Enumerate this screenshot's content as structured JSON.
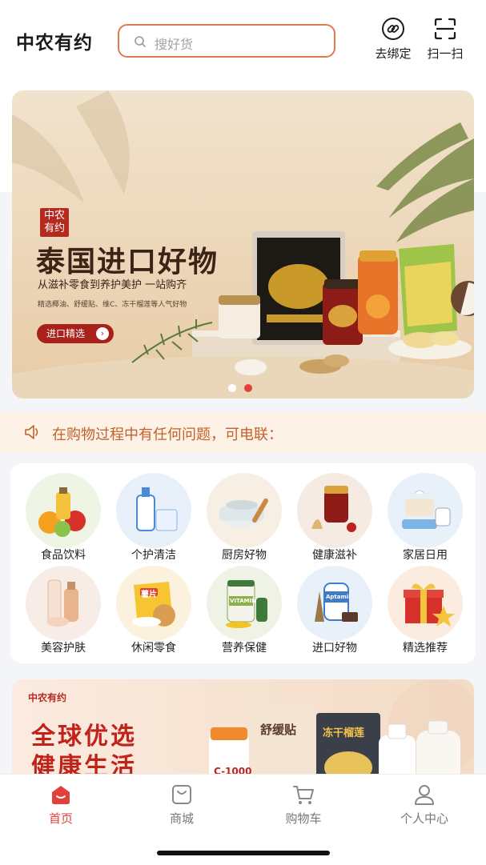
{
  "header": {
    "app_title": "中农有约",
    "search_placeholder": "搜好货",
    "bind_label": "去绑定",
    "scan_label": "扫一扫"
  },
  "banner": {
    "stamp_line1": "中农",
    "stamp_line2": "有约",
    "title": "泰国进口好物",
    "subtitle": "从滋补零食到养护美护 一站购齐",
    "description": "精选椰油、舒缓贴、维C、冻干榴莲等人气好物",
    "button_label": "进口精选",
    "button_arrow": "›",
    "slide_count": 2,
    "active_slide": 2
  },
  "notice": {
    "icon": "speaker-icon",
    "text": "在购物过程中有任何问题，可电联："
  },
  "categories": [
    {
      "label": "食品饮料",
      "icon": "fruit-drink-icon",
      "bg": "#eef5e4"
    },
    {
      "label": "个护清洁",
      "icon": "personal-care-icon",
      "bg": "#e8f0fa"
    },
    {
      "label": "厨房好物",
      "icon": "cookware-icon",
      "bg": "#f7efe4"
    },
    {
      "label": "健康滋补",
      "icon": "ginseng-tonic-icon",
      "bg": "#f6ebe2"
    },
    {
      "label": "家居日用",
      "icon": "household-icon",
      "bg": "#e8f0fa"
    },
    {
      "label": "美容护肤",
      "icon": "skincare-icon",
      "bg": "#f8ede6"
    },
    {
      "label": "休闲零食",
      "icon": "snack-icon",
      "bg": "#fbf1dc"
    },
    {
      "label": "营养保健",
      "icon": "vitamin-icon",
      "bg": "#eef3e6"
    },
    {
      "label": "进口好物",
      "icon": "imported-goods-icon",
      "bg": "#e8f0fa"
    },
    {
      "label": "精选推荐",
      "icon": "gift-box-icon",
      "bg": "#fbecdf"
    }
  ],
  "snack_chip_text": "薯片",
  "vitamin_text": "VITAMIN",
  "aptamil_text": "Aptamil",
  "promo": {
    "brand": "中农有约",
    "line1": "全球优选",
    "line2": "健康生活",
    "patch_label": "舒缓贴",
    "durian_label": "冻干榴莲",
    "vitc_label": "C-1000"
  },
  "tabbar": [
    {
      "label": "首页",
      "icon": "home-icon",
      "active": true
    },
    {
      "label": "商城",
      "icon": "shop-bag-icon",
      "active": false
    },
    {
      "label": "购物车",
      "icon": "cart-icon",
      "active": false
    },
    {
      "label": "个人中心",
      "icon": "user-icon",
      "active": false
    }
  ],
  "colors": {
    "accent": "#e0413a",
    "search_border": "#e07a52",
    "banner_button": "#a8211b",
    "notice_text": "#c4612a"
  }
}
